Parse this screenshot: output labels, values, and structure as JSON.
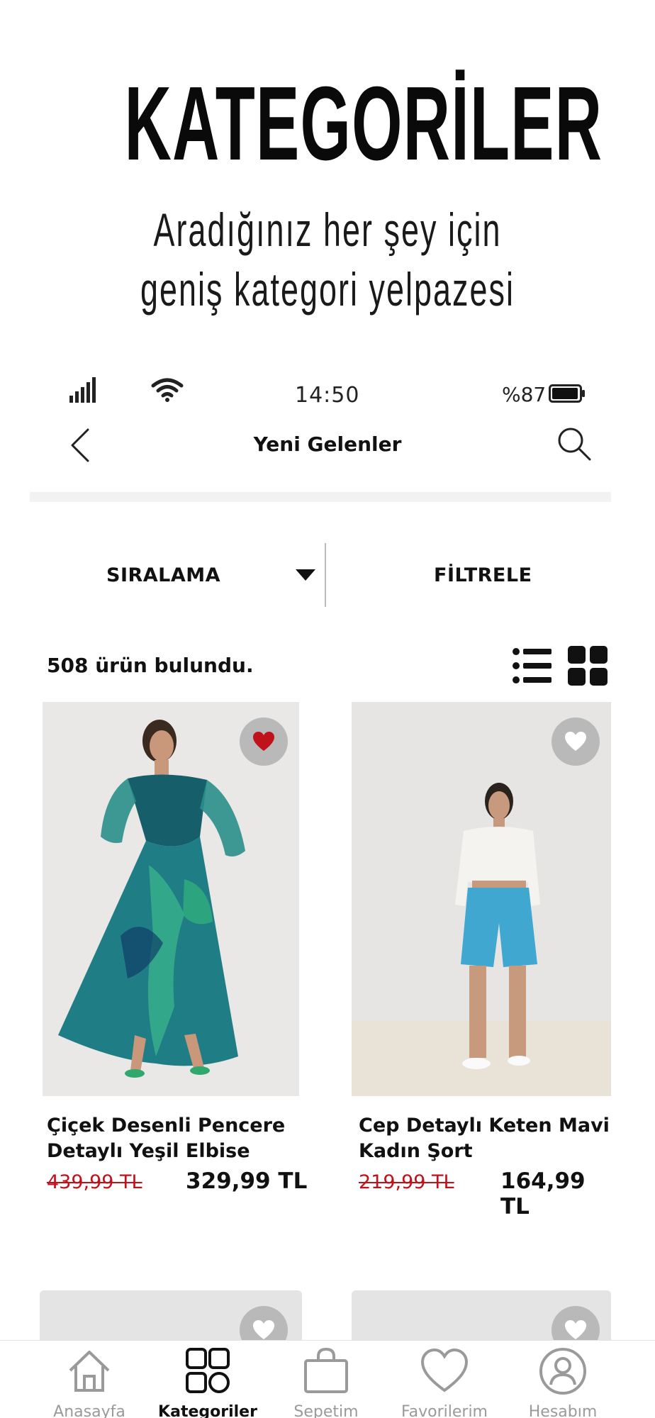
{
  "promo": {
    "title": "KATEGORİLER",
    "subtitle_line1": "Aradığınız her şey için",
    "subtitle_line2": "geniş kategori yelpazesi"
  },
  "status_bar": {
    "time": "14:50",
    "battery": "%87"
  },
  "header": {
    "title": "Yeni Gelenler"
  },
  "toolbar": {
    "sort_label": "SIRALAMA",
    "filter_label": "FİLTRELE"
  },
  "results": {
    "count_text": "508  ürün bulundu."
  },
  "products": [
    {
      "name_line1": "Çiçek Desenli Pencere",
      "name_line2": "Detaylı Yeşil Elbise",
      "old_price": "439,99 TL",
      "price": "329,99 TL",
      "favorited": true
    },
    {
      "name_line1": "Cep Detaylı Keten Mavi",
      "name_line2": "Kadın Şort",
      "old_price": "219,99 TL",
      "price": "164,99 TL",
      "favorited": false
    }
  ],
  "tabs": [
    {
      "label": "Anasayfa",
      "icon": "home-icon",
      "active": false
    },
    {
      "label": "Kategoriler",
      "icon": "categories-icon",
      "active": true
    },
    {
      "label": "Sepetim",
      "icon": "cart-icon",
      "active": false
    },
    {
      "label": "Favorilerim",
      "icon": "heart-icon",
      "active": false
    },
    {
      "label": "Hesabım",
      "icon": "account-icon",
      "active": false
    }
  ],
  "colors": {
    "old_price": "#c0121b",
    "favorite_active": "#c0121b",
    "tab_inactive": "#9a9a9a",
    "tab_active": "#111111"
  }
}
